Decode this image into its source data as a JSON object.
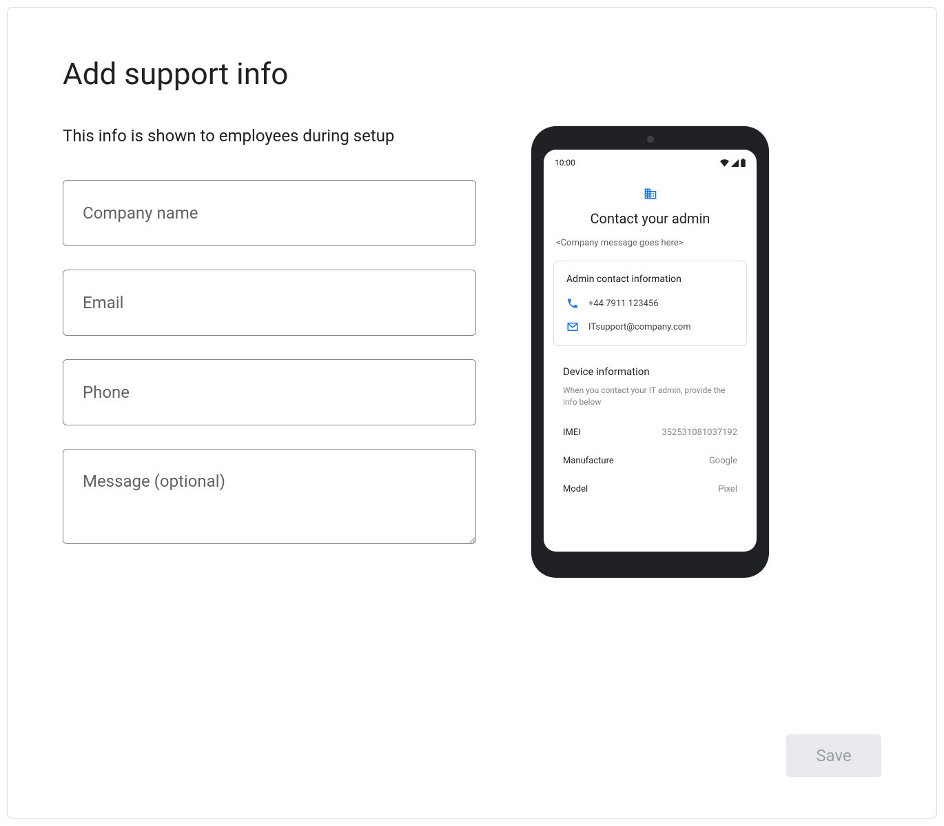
{
  "page": {
    "title": "Add support info",
    "subtitle": "This info is shown to employees during setup"
  },
  "form": {
    "company_placeholder": "Company name",
    "email_placeholder": "Email",
    "phone_placeholder": "Phone",
    "message_placeholder": "Message (optional)",
    "save_label": "Save"
  },
  "preview": {
    "status_time": "10:00",
    "heading": "Contact your admin",
    "company_message": "<Company message goes here>",
    "admin_card_title": "Admin contact information",
    "phone": "+44 7911 123456",
    "email": "ITsupport@company.com",
    "device_heading": "Device information",
    "device_helper": "When you contact your IT admin, provide the info below",
    "imei_label": "IMEI",
    "imei_value": "352531081037192",
    "manufacture_label": "Manufacture",
    "manufacture_value": "Google",
    "model_label": "Model",
    "model_value": "Pixel"
  },
  "colors": {
    "accent": "#1a73e8"
  }
}
